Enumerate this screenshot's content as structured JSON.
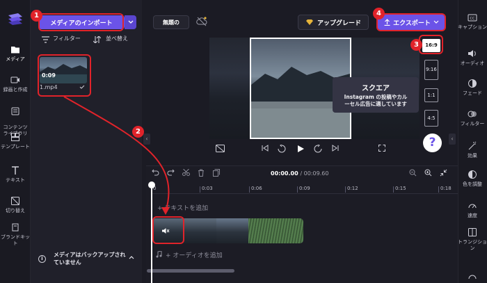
{
  "left_rail": {
    "items": [
      {
        "label": "メディア",
        "icon": "folder-icon"
      },
      {
        "label": "録画と作成",
        "icon": "camera-icon"
      },
      {
        "label": "コンテンツ\nライブラリ",
        "icon": "library-icon"
      },
      {
        "label": "テンプレート",
        "icon": "templates-icon"
      },
      {
        "label": "テキスト",
        "icon": "text-icon"
      },
      {
        "label": "切り替え",
        "icon": "transition-icon"
      },
      {
        "label": "ブランドキット",
        "icon": "brand-kit-icon"
      }
    ]
  },
  "media": {
    "import_label": "メディアのインポート",
    "filter_label": "フィルター",
    "sort_label": "並べ替え",
    "clip_duration": "0:09",
    "clip_name": "1.mp4",
    "backup_notice": "メディアはバックアップされていません"
  },
  "header": {
    "project_title": "無題の",
    "upgrade_label": "アップグレード",
    "export_label": "エクスポート"
  },
  "aspect_ratios": [
    "16:9",
    "9:16",
    "1:1",
    "4:5"
  ],
  "tooltip": {
    "title": "スクエア",
    "line1": "Instagram の投稿やカル",
    "line2": "ーセル広告に適しています"
  },
  "help_label": "?",
  "timeline": {
    "current_time": "00:00.00",
    "total_time": "/ 00:09.60",
    "ticks": [
      "0",
      "0:03",
      "0:06",
      "0:09",
      "0:12",
      "0:15",
      "0:18"
    ],
    "text_placeholder": "+ テキストを追加",
    "audio_placeholder": "+ オーディオを追加"
  },
  "right_rail": {
    "items": [
      {
        "label": "キャプション",
        "icon": "captions-icon"
      },
      {
        "label": "オーディオ",
        "icon": "speaker-icon"
      },
      {
        "label": "フェード",
        "icon": "fade-icon"
      },
      {
        "label": "フィルター",
        "icon": "filters-icon"
      },
      {
        "label": "効果",
        "icon": "effects-icon"
      },
      {
        "label": "色を調整",
        "icon": "color-icon"
      },
      {
        "label": "速度",
        "icon": "speed-icon"
      },
      {
        "label": "トランジション",
        "icon": "transitions-icon"
      }
    ]
  },
  "annotations": [
    "1",
    "2",
    "3",
    "4"
  ],
  "colors": {
    "accent": "#6b53e8",
    "annotation": "#e1232a",
    "background": "#1b1b24"
  }
}
